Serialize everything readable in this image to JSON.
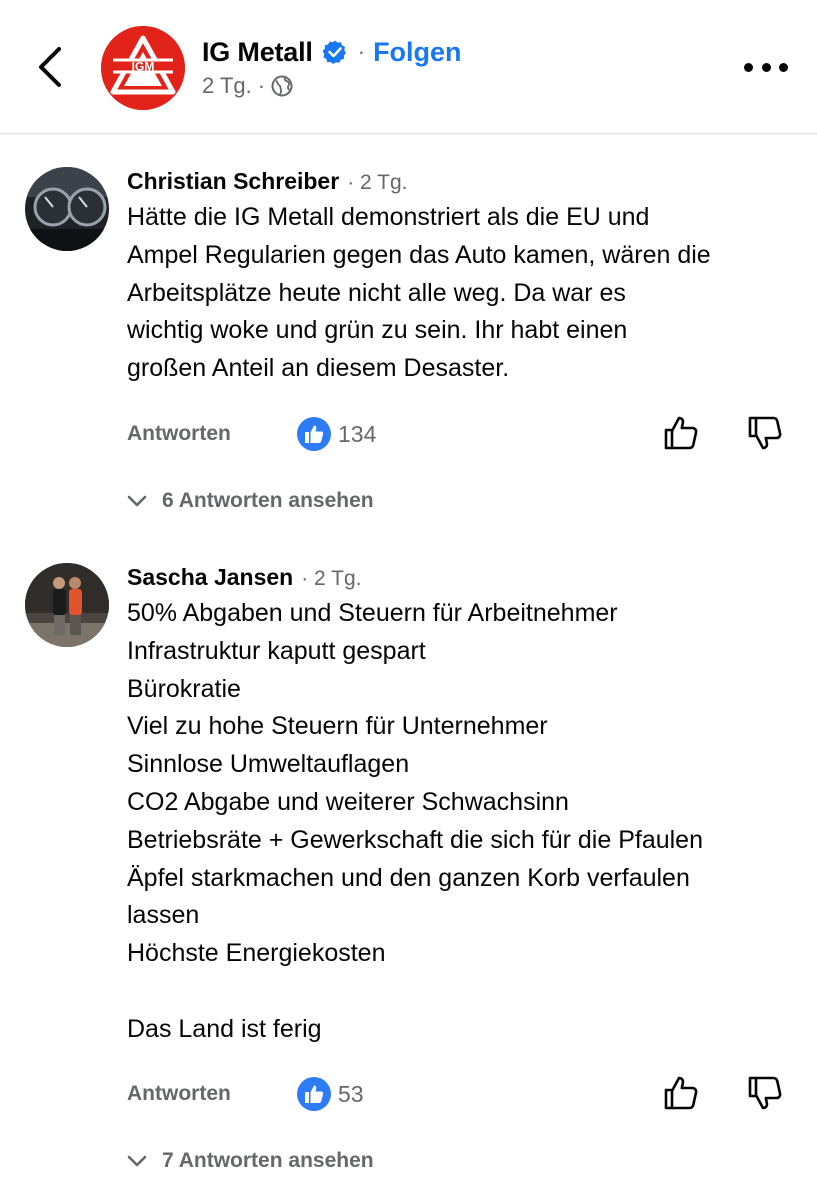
{
  "header": {
    "page_name": "IG Metall",
    "follow_label": "Folgen",
    "separator": "·",
    "time": "2 Tg.",
    "logo_text": "IGM",
    "accent_color": "#1877f2",
    "brand_color": "#e2231a",
    "icons": {
      "back": "chevron-left-icon",
      "verified": "verified-badge-icon",
      "audience": "globe-icon",
      "more": "more-dots-icon"
    }
  },
  "comments": [
    {
      "author": "Christian Schreiber",
      "time": "2 Tg.",
      "text": "Hätte die IG Metall demonstriert als die EU und\nAmpel Regularien gegen das Auto kamen, wären die\nArbeitsplätze heute nicht alle weg. Da war es\nwichtig woke und grün zu sein. Ihr habt einen\ngroßen Anteil an diesem Desaster.",
      "reply_label": "Antworten",
      "likes": "134",
      "view_replies": "6 Antworten ansehen"
    },
    {
      "author": "Sascha Jansen",
      "time": "2 Tg.",
      "text": "50% Abgaben und Steuern für Arbeitnehmer\nInfrastruktur kaputt gespart\nBürokratie\nViel zu hohe Steuern für Unternehmer\nSinnlose Umweltauflagen\nCO2 Abgabe und weiterer Schwachsinn\nBetriebsräte + Gewerkschaft die sich für die Pfaulen\nÄpfel starkmachen und den ganzen Korb verfaulen\nlassen\nHöchste Energiekosten\n\nDas Land ist ferig",
      "reply_label": "Antworten",
      "likes": "53",
      "view_replies": "7 Antworten ansehen"
    }
  ]
}
